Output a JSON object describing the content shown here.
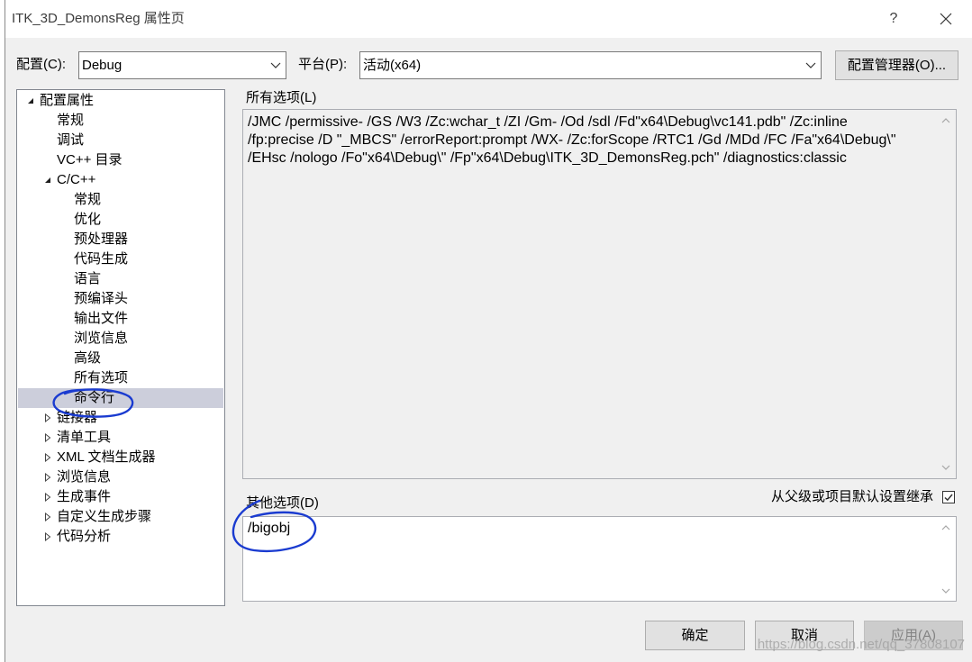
{
  "window": {
    "title": "ITK_3D_DemonsReg 属性页",
    "help_label": "?"
  },
  "toolbar": {
    "config_label": "配置(C):",
    "config_value": "Debug",
    "platform_label": "平台(P):",
    "platform_value": "活动(x64)",
    "config_manager_label": "配置管理器(O)..."
  },
  "tree": {
    "root": {
      "label": "配置属性",
      "expanded": true,
      "children": [
        {
          "label": "常规"
        },
        {
          "label": "调试"
        },
        {
          "label": "VC++ 目录"
        },
        {
          "label": "C/C++",
          "expanded": true,
          "children": [
            {
              "label": "常规"
            },
            {
              "label": "优化"
            },
            {
              "label": "预处理器"
            },
            {
              "label": "代码生成"
            },
            {
              "label": "语言"
            },
            {
              "label": "预编译头"
            },
            {
              "label": "输出文件"
            },
            {
              "label": "浏览信息"
            },
            {
              "label": "高级"
            },
            {
              "label": "所有选项"
            },
            {
              "label": "命令行",
              "selected": true
            }
          ]
        },
        {
          "label": "链接器",
          "expanded": false
        },
        {
          "label": "清单工具",
          "expanded": false
        },
        {
          "label": "XML 文档生成器",
          "expanded": false
        },
        {
          "label": "浏览信息",
          "expanded": false
        },
        {
          "label": "生成事件",
          "expanded": false
        },
        {
          "label": "自定义生成步骤",
          "expanded": false
        },
        {
          "label": "代码分析",
          "expanded": false
        }
      ]
    }
  },
  "all_options": {
    "label": "所有选项(L)",
    "lines": [
      "/JMC /permissive- /GS /W3 /Zc:wchar_t /ZI /Gm- /Od /sdl /Fd\"x64\\Debug\\vc141.pdb\" /Zc:inline",
      "/fp:precise /D \"_MBCS\" /errorReport:prompt /WX- /Zc:forScope /RTC1 /Gd /MDd /FC /Fa\"x64\\Debug\\\"",
      "/EHsc /nologo /Fo\"x64\\Debug\\\" /Fp\"x64\\Debug\\ITK_3D_DemonsReg.pch\" /diagnostics:classic"
    ]
  },
  "other_options": {
    "label": "其他选项(D)",
    "value": "/bigobj",
    "inherit_label": "从父级或项目默认设置继承",
    "inherit_checked": true
  },
  "buttons": {
    "ok_label": "确定",
    "cancel_label": "取消",
    "apply_label": "应用(A)",
    "apply_enabled": false
  },
  "watermark": "https://blog.csdn.net/qq_37808107",
  "colors": {
    "dialog_bg": "#f0f0f0",
    "selected_row": "#cccedb",
    "annotation": "#1a3bd0",
    "disabled_text": "#838383"
  },
  "icons": {
    "close": "close-icon",
    "dropdown": "chevron-down-icon",
    "expanded": "expanded-triangle-icon",
    "collapsed": "collapsed-triangle-icon",
    "checkbox": "checkmark-icon",
    "scroll_up": "scroll-up-arrow-icon",
    "scroll_down": "scroll-down-arrow-icon"
  }
}
